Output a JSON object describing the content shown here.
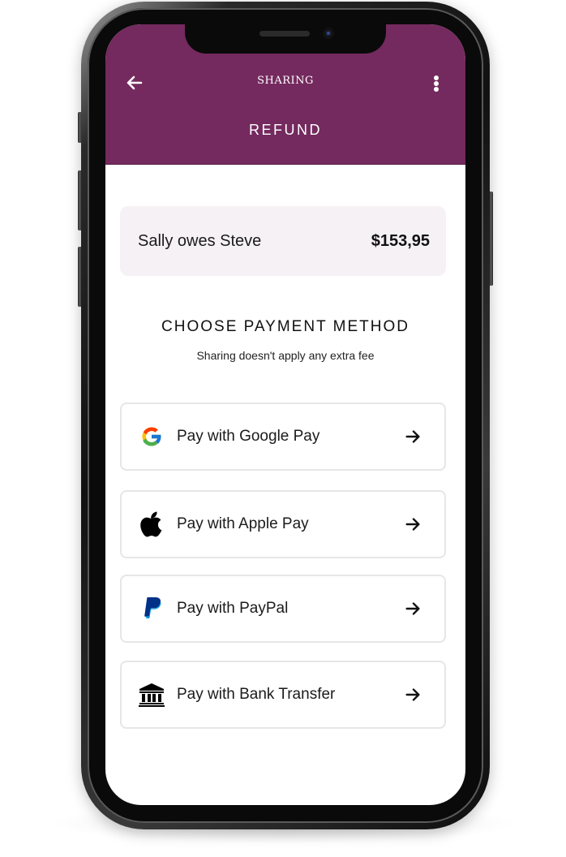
{
  "header": {
    "title": "SHARING",
    "subtitle": "REFUND",
    "background_color": "#742a5e"
  },
  "summary": {
    "text": "Sally owes Steve",
    "amount": "$153,95"
  },
  "section": {
    "title": "CHOOSE PAYMENT METHOD",
    "subtitle": "Sharing doesn't apply any extra fee"
  },
  "payment_options": [
    {
      "label": "Pay with Google Pay",
      "icon": "google-icon"
    },
    {
      "label": "Pay with Apple Pay",
      "icon": "apple-icon"
    },
    {
      "label": "Pay with PayPal",
      "icon": "paypal-icon"
    },
    {
      "label": "Pay with Bank Transfer",
      "icon": "bank-icon"
    }
  ],
  "icons": {
    "back": "arrow-left-icon",
    "more": "more-vertical-icon",
    "option_arrow": "arrow-right-icon"
  }
}
